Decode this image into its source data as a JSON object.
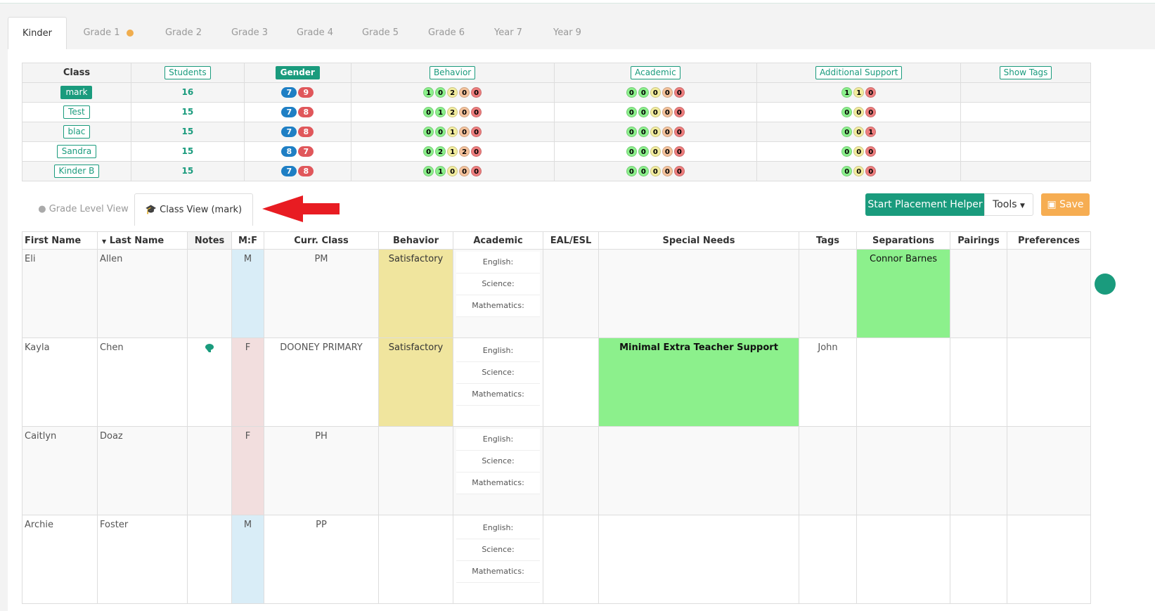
{
  "grade_tabs": [
    {
      "label": "Kinder",
      "active": true
    },
    {
      "label": "Grade 1",
      "has_dot": true
    },
    {
      "label": "Grade 2"
    },
    {
      "label": "Grade 3"
    },
    {
      "label": "Grade 4"
    },
    {
      "label": "Grade 5"
    },
    {
      "label": "Grade 6"
    },
    {
      "label": "Year 7"
    },
    {
      "label": "Year 9"
    }
  ],
  "summary": {
    "headers": {
      "class": "Class",
      "students": "Students",
      "gender": "Gender",
      "behavior": "Behavior",
      "academic": "Academic",
      "support": "Additional Support",
      "tags": "Show Tags"
    },
    "rows": [
      {
        "class": "mark",
        "selected": true,
        "students": "16",
        "gender": [
          "7",
          "9"
        ],
        "behavior": [
          "1",
          "0",
          "2",
          "0",
          "0"
        ],
        "academic": [
          "0",
          "0",
          "0",
          "0",
          "0"
        ],
        "support": [
          "1",
          "1",
          "0"
        ]
      },
      {
        "class": "Test",
        "students": "15",
        "gender": [
          "7",
          "8"
        ],
        "behavior": [
          "0",
          "1",
          "2",
          "0",
          "0"
        ],
        "academic": [
          "0",
          "0",
          "0",
          "0",
          "0"
        ],
        "support": [
          "0",
          "0",
          "0"
        ]
      },
      {
        "class": "blac",
        "students": "15",
        "gender": [
          "7",
          "8"
        ],
        "behavior": [
          "0",
          "0",
          "1",
          "0",
          "0"
        ],
        "academic": [
          "0",
          "0",
          "0",
          "0",
          "0"
        ],
        "support": [
          "0",
          "0",
          "1"
        ]
      },
      {
        "class": "Sandra",
        "students": "15",
        "gender": [
          "8",
          "7"
        ],
        "behavior": [
          "0",
          "2",
          "1",
          "2",
          "0"
        ],
        "academic": [
          "0",
          "0",
          "0",
          "0",
          "0"
        ],
        "support": [
          "0",
          "0",
          "0"
        ]
      },
      {
        "class": "Kinder B",
        "students": "15",
        "gender": [
          "7",
          "8"
        ],
        "behavior": [
          "0",
          "1",
          "0",
          "0",
          "0"
        ],
        "academic": [
          "0",
          "0",
          "0",
          "0",
          "0"
        ],
        "support": [
          "0",
          "0",
          "0"
        ]
      }
    ]
  },
  "view_tabs": {
    "grade_level": "Grade Level View",
    "class_view": "Class View (mark)"
  },
  "buttons": {
    "placement": "Start Placement Helper",
    "tools": "Tools",
    "save": "Save"
  },
  "students_table": {
    "headers": {
      "first": "First Name",
      "last": "Last Name",
      "notes": "Notes",
      "mf": "M:F",
      "curr_class": "Curr. Class",
      "behavior": "Behavior",
      "academic": "Academic",
      "eal": "EAL/ESL",
      "special": "Special Needs",
      "tags": "Tags",
      "separations": "Separations",
      "pairings": "Pairings",
      "preferences": "Preferences"
    },
    "subjects": {
      "english": "English:",
      "science": "Science:",
      "mathematics": "Mathematics:"
    },
    "rows": [
      {
        "first": "Eli",
        "last": "Allen",
        "gender": "M",
        "curr_class": "PM",
        "behavior": "Satisfactory",
        "special": "",
        "tags": "",
        "separations": "Connor Barnes"
      },
      {
        "first": "Kayla",
        "last": "Chen",
        "gender": "F",
        "curr_class": "DOONEY PRIMARY",
        "behavior": "Satisfactory",
        "special": "Minimal Extra Teacher Support",
        "tags": "John",
        "separations": ""
      },
      {
        "first": "Caitlyn",
        "last": "Doaz",
        "gender": "F",
        "curr_class": "PH",
        "behavior": "",
        "special": "",
        "tags": "",
        "separations": ""
      },
      {
        "first": "Archie",
        "last": "Foster",
        "gender": "M",
        "curr_class": "PP",
        "behavior": "",
        "special": "",
        "tags": "",
        "separations": ""
      }
    ]
  },
  "colors": {
    "accent": "#1a9b7d",
    "save": "#f6ad52",
    "male": "#d9edf7",
    "female": "#f2dede",
    "behavior": "#f0e59e",
    "highlight": "#8cf08c"
  }
}
